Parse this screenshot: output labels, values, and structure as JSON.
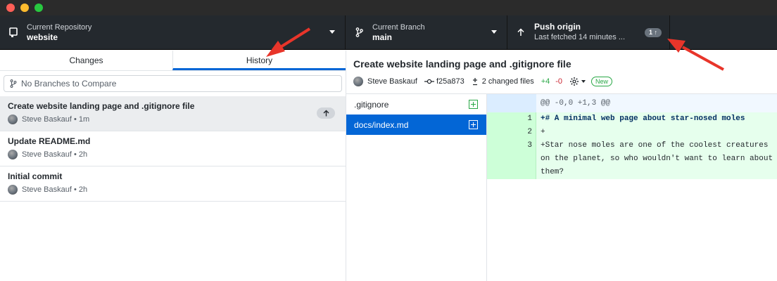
{
  "toolbar": {
    "repo": {
      "label": "Current Repository",
      "value": "website"
    },
    "branch": {
      "label": "Current Branch",
      "value": "main"
    },
    "push": {
      "label": "Push origin",
      "sub": "Last fetched 14 minutes ...",
      "badge": "1 ↑"
    }
  },
  "tabs": [
    {
      "label": "Changes",
      "selected": false
    },
    {
      "label": "History",
      "selected": true
    }
  ],
  "compare_placeholder": "No Branches to Compare",
  "commits": [
    {
      "title": "Create website landing page and .gitignore file",
      "author": "Steve Baskauf",
      "age": "1m",
      "selected": true,
      "unpushed": true
    },
    {
      "title": "Update README.md",
      "author": "Steve Baskauf",
      "age": "2h",
      "selected": false
    },
    {
      "title": "Initial commit",
      "author": "Steve Baskauf",
      "age": "2h",
      "selected": false
    }
  ],
  "commit_detail": {
    "title": "Create website landing page and .gitignore file",
    "author": "Steve Baskauf",
    "sha": "f25a873",
    "changed_files": "2 changed files",
    "additions": "+4",
    "deletions": "-0",
    "new_badge": "New"
  },
  "files": [
    {
      "name": ".gitignore",
      "selected": false
    },
    {
      "name": "docs/index.md",
      "selected": true
    }
  ],
  "diff": {
    "hunk": "@@ -0,0 +1,3 @@",
    "lines": [
      {
        "num": "1",
        "text": "+# A minimal web page about star-nosed moles"
      },
      {
        "num": "2",
        "text": "+"
      },
      {
        "num": "3",
        "text": "+Star nose moles are one of the coolest creatures on the planet, so who wouldn't want to learn about them?"
      }
    ]
  },
  "colors": {
    "accent": "#0366d6",
    "toolbar_bg": "#24292e",
    "annotation_arrow": "#e8352a",
    "added": "#28a745",
    "deleted": "#cb2431"
  }
}
